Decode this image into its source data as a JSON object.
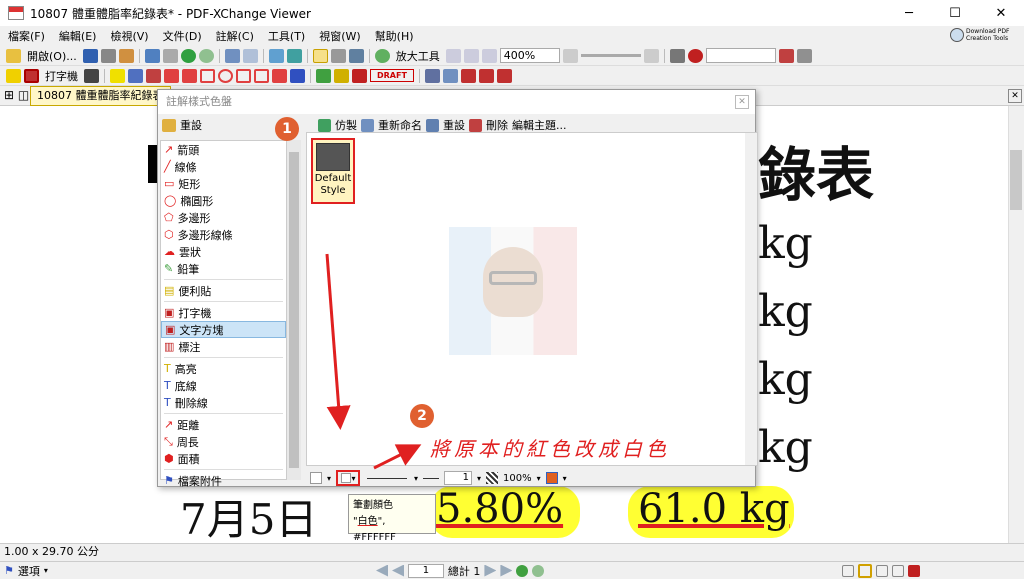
{
  "window": {
    "title": "10807 體重體脂率紀錄表* - PDF-XChange Viewer",
    "min": "─",
    "max": "☐",
    "close": "✕"
  },
  "menu": [
    "檔案(F)",
    "編輯(E)",
    "檢視(V)",
    "文件(D)",
    "註解(C)",
    "工具(T)",
    "視窗(W)",
    "幫助(H)"
  ],
  "download": {
    "line1": "Download PDF",
    "line2": "Creation Tools"
  },
  "toolbar1": {
    "open": "開啟(O)...",
    "bigtool": "放大工具",
    "zoom": "400%"
  },
  "toolbar2": {
    "typewriter": "打字機",
    "draft": "DRAFT"
  },
  "doctab": {
    "label": "10807 體重體脂率紀錄表"
  },
  "document": {
    "title_part": "錄表",
    "kg": "kg",
    "date": "7月5日",
    "percent": "5.80%",
    "weight": "61.0 kg"
  },
  "dialog": {
    "title": "註解樣式色盤",
    "toolbar": {
      "copy": "仿製",
      "rename": "重新命名",
      "reset": "重設",
      "delete": "刪除",
      "edit_theme": "編輯主題..."
    },
    "list_header": "重設",
    "items": [
      {
        "label": "箭頭",
        "icon": "arrow-icon"
      },
      {
        "label": "線條",
        "icon": "line-icon"
      },
      {
        "label": "矩形",
        "icon": "rectangle-icon"
      },
      {
        "label": "橢圓形",
        "icon": "ellipse-icon"
      },
      {
        "label": "多邊形",
        "icon": "polygon-icon"
      },
      {
        "label": "多邊形線條",
        "icon": "polyline-icon"
      },
      {
        "label": "雲狀",
        "icon": "cloud-icon"
      },
      {
        "label": "鉛筆",
        "icon": "pencil-icon"
      },
      {
        "label": "便利貼",
        "icon": "sticky-note-icon"
      },
      {
        "label": "打字機",
        "icon": "typewriter-icon"
      },
      {
        "label": "文字方塊",
        "icon": "textbox-icon"
      },
      {
        "label": "標注",
        "icon": "callout-icon"
      },
      {
        "label": "高亮",
        "icon": "highlight-icon"
      },
      {
        "label": "底線",
        "icon": "underline-icon"
      },
      {
        "label": "刪除線",
        "icon": "strikeout-icon"
      },
      {
        "label": "距離",
        "icon": "distance-icon"
      },
      {
        "label": "周長",
        "icon": "perimeter-icon"
      },
      {
        "label": "面積",
        "icon": "area-icon"
      },
      {
        "label": "檔案附件",
        "icon": "attachment-icon"
      }
    ],
    "style_tile": {
      "line1": "Default",
      "line2": "Style"
    },
    "bottom": {
      "width": "1",
      "opacity": "100%"
    }
  },
  "tooltip": {
    "title": "筆劃顏色",
    "quote_open": "\"",
    "value_name": "白色",
    "quote_close": "\"",
    "value_hex": ", #FFFFFF"
  },
  "annotation": {
    "badge1": "1",
    "badge2": "2",
    "note": "將原本的紅色改成白色"
  },
  "status": {
    "size": "1.00 x 29.70 公分"
  },
  "bottom": {
    "options": "選項",
    "page": "1",
    "total": "總計 1"
  },
  "colors": {
    "accent": "#e02020",
    "highlight": "#ffff33",
    "selection": "#cce4f7"
  }
}
